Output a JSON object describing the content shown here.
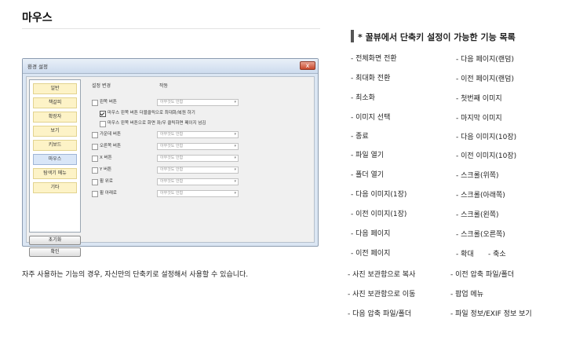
{
  "page_title": "마우스",
  "dialog": {
    "title": "환경 설정",
    "close_glyph": "x",
    "menu": [
      "일반",
      "책갈피",
      "확장자",
      "보기",
      "키보드",
      "마우스",
      "탐색기 메뉴",
      "기타"
    ],
    "active_menu": "마우스",
    "reset_label": "초기화",
    "ok_label": "확인",
    "col_setting": "설정 변경",
    "col_action": "작동",
    "combo_value": "아무것도 안함",
    "options": {
      "left": "왼쪽 버튼",
      "left_sub1": "마우스 왼쪽 버튼 더블클릭으로 최대화/복원 하기",
      "left_sub2": "마우스 왼쪽 버튼으로 화면 좌/우 클릭하면 페이지 넘김",
      "middle": "가운데 버튼",
      "right": "오른쪽 버튼",
      "x": "X 버튼",
      "y": "Y 버튼",
      "wheel_up": "휠 위로",
      "wheel_down": "휠 아래로"
    }
  },
  "caption": "자주 사용하는 기능의 경우, 자신만의 단축키로 설정해서 사용할 수 있습니다.",
  "list_title": "* 꿀뷰에서 단축키 설정이 가능한 기능 목록",
  "left_items": [
    "- 전체화면 전환",
    "- 최대화 전환",
    "- 최소화",
    "- 이미지 선택",
    "- 종료",
    "- 파일 열기",
    "- 폴더 열기",
    "- 다음 이미지(1장)",
    "- 이전 이미지(1장)",
    "- 다음 페이지",
    "- 이전 페이지"
  ],
  "right_items": [
    "- 다음 페이지(랜덤)",
    "- 이전 페이지(랜덤)",
    "- 첫번째 이미지",
    "- 마지막 이미지",
    "- 다음 이미지(10장)",
    "- 이전 이미지(10장)",
    "- 스크롤(위쪽)",
    "- 스크롤(아래쪽)",
    "- 스크롤(왼쪽)",
    "- 스크롤(오른쪽)",
    "- 확대",
    "- 축소"
  ],
  "bottom_left_items": [
    "- 사진 보관함으로 복사",
    "- 사진 보관함으로 이동",
    "- 다음 압축 파일/폴더"
  ],
  "bottom_right_items": [
    "- 이전 압축 파일/폴더",
    "- 팝업 메뉴",
    "- 파일 정보/EXIF 정보 보기"
  ]
}
